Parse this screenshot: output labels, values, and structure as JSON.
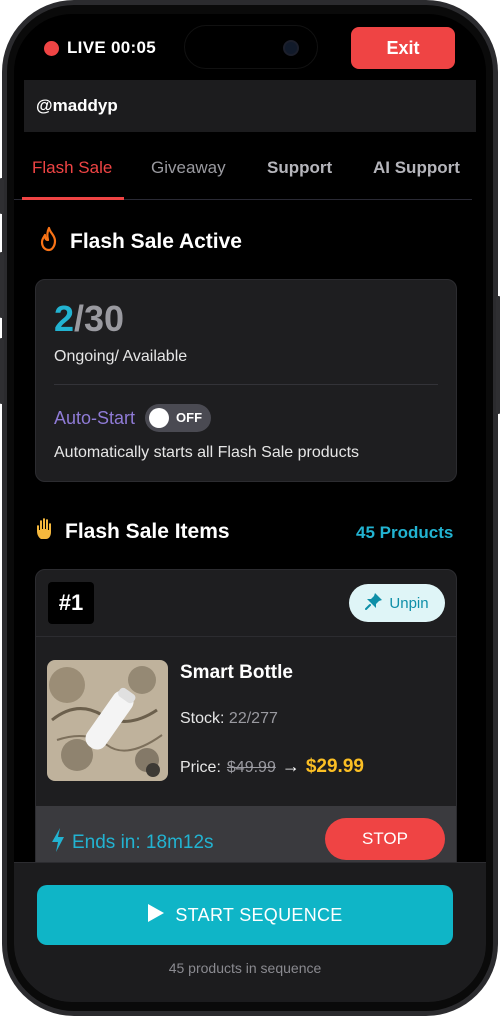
{
  "status": {
    "live_label": "LIVE 00:05",
    "exit_label": "Exit"
  },
  "user": {
    "handle": "@maddyp"
  },
  "tabs": [
    {
      "label": "Flash Sale",
      "active": true
    },
    {
      "label": "Giveaway",
      "active": false
    },
    {
      "label": "Support",
      "active": false
    },
    {
      "label": "AI Support",
      "active": false
    }
  ],
  "flash_sale": {
    "title": "Flash Sale Active",
    "ongoing": "2",
    "available": "/30",
    "counts_label": "Ongoing/ Available",
    "auto_start_label": "Auto-Start",
    "toggle_state": "OFF",
    "auto_start_desc": "Automatically starts all Flash Sale products"
  },
  "items_section": {
    "title": "Flash Sale Items",
    "count_label": "45 Products"
  },
  "item": {
    "rank": "#1",
    "unpin_label": "Unpin",
    "name": "Smart Bottle",
    "stock_label": "Stock:",
    "stock_value": "22/277",
    "price_label": "Price:",
    "old_price": "$49.99",
    "arrow": "→",
    "new_price": "$29.99",
    "ends_label": "Ends in: 18m12s",
    "stop_label": "STOP"
  },
  "footer": {
    "start_label": "START SEQUENCE",
    "note": "45 products in sequence"
  },
  "colors": {
    "accent_red": "#ef4444",
    "accent_cyan": "#22b3d1",
    "price_yellow": "#fbbf24",
    "auto_purple": "#8f7bd6"
  },
  "icons": [
    "flame-icon",
    "hand-icon",
    "pin-icon",
    "bolt-icon",
    "play-icon"
  ]
}
